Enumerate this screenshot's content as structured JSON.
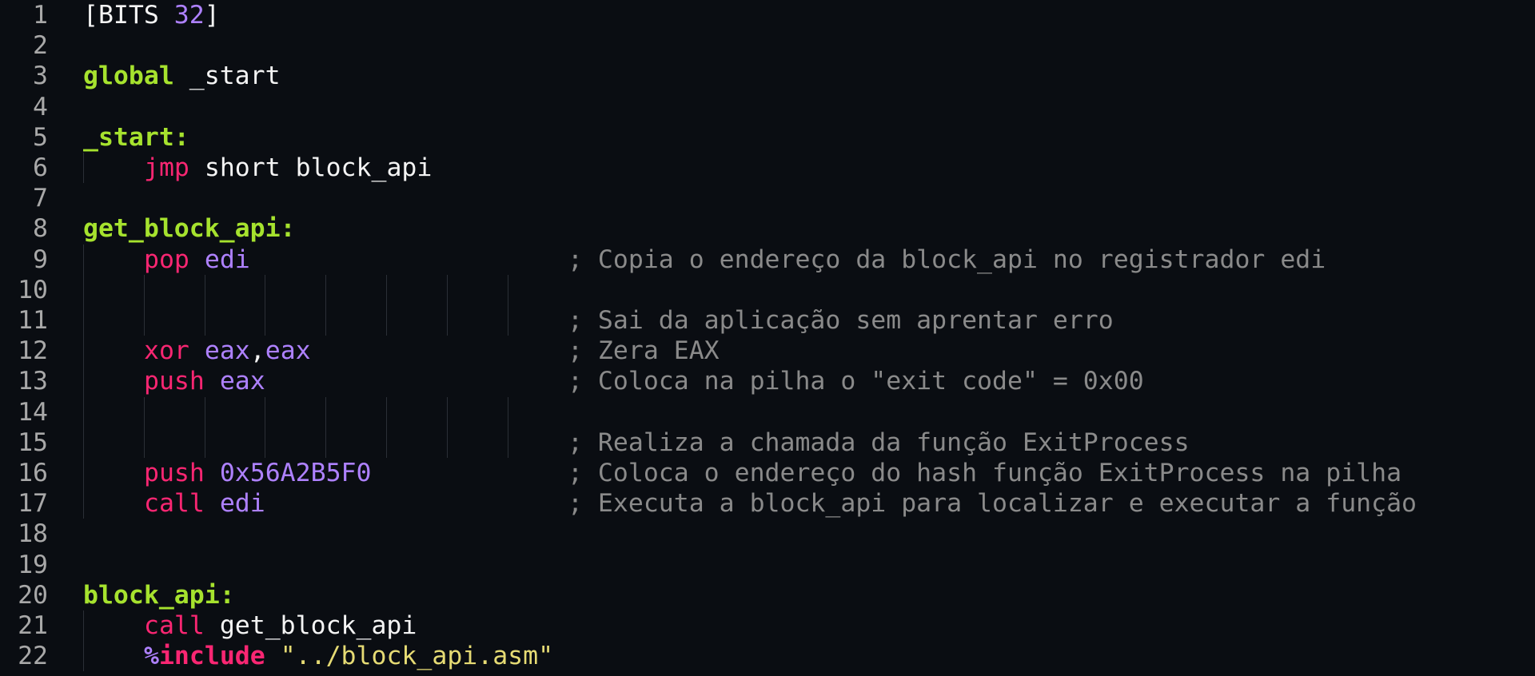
{
  "editor": {
    "colors": {
      "background": "#0a0d12",
      "line_number": "#a8a8a8",
      "plain": "#f4f4f4",
      "keyword_label": "#a6e22e",
      "instruction": "#f92672",
      "register_number": "#ae81ff",
      "string": "#e6db74",
      "comment": "#8a8a8a"
    },
    "lines": [
      {
        "n": "1",
        "indent": 0,
        "guides": 0,
        "tokens": [
          {
            "t": "[BITS ",
            "c": "plain"
          },
          {
            "t": "32",
            "c": "num"
          },
          {
            "t": "]",
            "c": "plain"
          }
        ],
        "comment": ""
      },
      {
        "n": "2",
        "indent": 0,
        "guides": 0,
        "tokens": [],
        "comment": ""
      },
      {
        "n": "3",
        "indent": 0,
        "guides": 0,
        "tokens": [
          {
            "t": "global",
            "c": "kw"
          },
          {
            "t": " _start",
            "c": "plain"
          }
        ],
        "comment": ""
      },
      {
        "n": "4",
        "indent": 0,
        "guides": 0,
        "tokens": [],
        "comment": ""
      },
      {
        "n": "5",
        "indent": 0,
        "guides": 0,
        "tokens": [
          {
            "t": "_start:",
            "c": "label"
          }
        ],
        "comment": ""
      },
      {
        "n": "6",
        "indent": 1,
        "guides": 1,
        "tokens": [
          {
            "t": "jmp",
            "c": "op"
          },
          {
            "t": " short block_api",
            "c": "plain"
          }
        ],
        "comment": ""
      },
      {
        "n": "7",
        "indent": 0,
        "guides": 0,
        "tokens": [],
        "comment": ""
      },
      {
        "n": "8",
        "indent": 0,
        "guides": 0,
        "tokens": [
          {
            "t": "get_block_api:",
            "c": "label"
          }
        ],
        "comment": ""
      },
      {
        "n": "9",
        "indent": 1,
        "guides": 1,
        "tokens": [
          {
            "t": "pop",
            "c": "op"
          },
          {
            "t": " ",
            "c": "plain"
          },
          {
            "t": "edi",
            "c": "reg"
          }
        ],
        "comment": "; Copia o endereço da block_api no registrador edi"
      },
      {
        "n": "10",
        "indent": 0,
        "guides": 8,
        "tokens": [],
        "comment": ""
      },
      {
        "n": "11",
        "indent": 0,
        "guides": 8,
        "tokens": [],
        "comment": "; Sai da aplicação sem aprentar erro"
      },
      {
        "n": "12",
        "indent": 1,
        "guides": 1,
        "tokens": [
          {
            "t": "xor",
            "c": "op"
          },
          {
            "t": " ",
            "c": "plain"
          },
          {
            "t": "eax",
            "c": "reg"
          },
          {
            "t": ",",
            "c": "plain"
          },
          {
            "t": "eax",
            "c": "reg"
          }
        ],
        "comment": "; Zera EAX"
      },
      {
        "n": "13",
        "indent": 1,
        "guides": 1,
        "tokens": [
          {
            "t": "push",
            "c": "op"
          },
          {
            "t": " ",
            "c": "plain"
          },
          {
            "t": "eax",
            "c": "reg"
          }
        ],
        "comment": "; Coloca na pilha o \"exit code\" = 0x00"
      },
      {
        "n": "14",
        "indent": 0,
        "guides": 8,
        "tokens": [],
        "comment": ""
      },
      {
        "n": "15",
        "indent": 0,
        "guides": 8,
        "tokens": [],
        "comment": "; Realiza a chamada da função ExitProcess"
      },
      {
        "n": "16",
        "indent": 1,
        "guides": 1,
        "tokens": [
          {
            "t": "push",
            "c": "op"
          },
          {
            "t": " ",
            "c": "plain"
          },
          {
            "t": "0x56A2B5F0",
            "c": "num"
          }
        ],
        "comment": "; Coloca o endereço do hash função ExitProcess na pilha"
      },
      {
        "n": "17",
        "indent": 1,
        "guides": 1,
        "tokens": [
          {
            "t": "call",
            "c": "op"
          },
          {
            "t": " ",
            "c": "plain"
          },
          {
            "t": "edi",
            "c": "reg"
          }
        ],
        "comment": "; Executa a block_api para localizar e executar a função"
      },
      {
        "n": "18",
        "indent": 0,
        "guides": 0,
        "tokens": [],
        "comment": ""
      },
      {
        "n": "19",
        "indent": 0,
        "guides": 0,
        "tokens": [],
        "comment": ""
      },
      {
        "n": "20",
        "indent": 0,
        "guides": 0,
        "tokens": [
          {
            "t": "block_api:",
            "c": "label"
          }
        ],
        "comment": ""
      },
      {
        "n": "21",
        "indent": 1,
        "guides": 1,
        "tokens": [
          {
            "t": "call",
            "c": "op"
          },
          {
            "t": " get_block_api",
            "c": "plain"
          }
        ],
        "comment": ""
      },
      {
        "n": "22",
        "indent": 1,
        "guides": 1,
        "tokens": [
          {
            "t": "%",
            "c": "dirsym"
          },
          {
            "t": "include",
            "c": "dir"
          },
          {
            "t": " ",
            "c": "plain"
          },
          {
            "t": "\"../block_api.asm\"",
            "c": "str"
          }
        ],
        "comment": ""
      }
    ]
  }
}
